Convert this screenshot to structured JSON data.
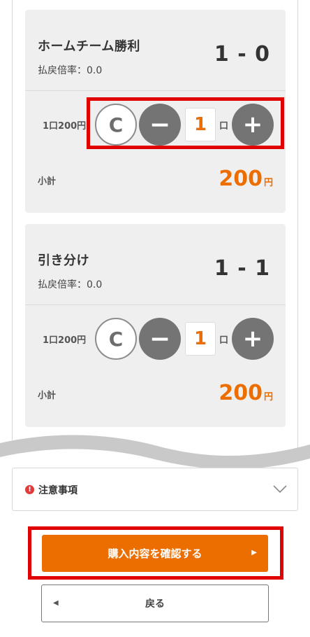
{
  "bets": [
    {
      "title": "ホームチーム勝利",
      "odds_label": "払戻倍率：0.0",
      "score": "1 - 0",
      "unit_price": "1口200円",
      "clear_label": "C",
      "minus_label": "−",
      "plus_label": "+",
      "quantity": "1",
      "quantity_unit": "口",
      "subtotal_label": "小計",
      "subtotal_value": "200",
      "subtotal_unit": "円"
    },
    {
      "title": "引き分け",
      "odds_label": "払戻倍率：0.0",
      "score": "1 - 1",
      "unit_price": "1口200円",
      "clear_label": "C",
      "minus_label": "−",
      "plus_label": "+",
      "quantity": "1",
      "quantity_unit": "口",
      "subtotal_label": "小計",
      "subtotal_value": "200",
      "subtotal_unit": "円"
    }
  ],
  "notice": {
    "label": "注意事項",
    "icon": "alert-icon",
    "icon_glyph": "!",
    "expand_icon": "chevron-down-icon"
  },
  "actions": {
    "confirm_label": "購入内容を確認する",
    "confirm_arrow": "▶",
    "back_label": "戻る",
    "back_arrow": "◀"
  },
  "colors": {
    "accent": "#ec6d00",
    "highlight": "#e00000",
    "stepper": "#747474",
    "card_bg": "#efefef"
  }
}
